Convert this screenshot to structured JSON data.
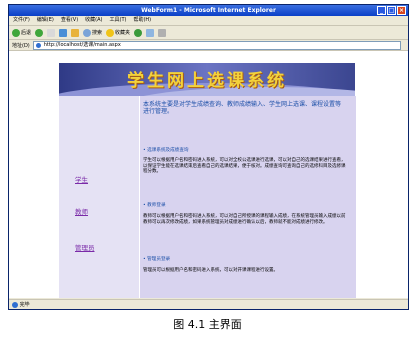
{
  "window": {
    "title": "WebForm1 - Microsoft Internet Explorer",
    "controls": {
      "min": "_",
      "max": "□",
      "close": "×"
    }
  },
  "menu": [
    "文件(F)",
    "编辑(E)",
    "查看(V)",
    "收藏(A)",
    "工具(T)",
    "帮助(H)"
  ],
  "toolbar": {
    "back": "后退",
    "search": "搜索",
    "favorites": "收藏夹"
  },
  "address": {
    "label": "地址(D)",
    "url": "http://localhost/选课/main.aspx"
  },
  "banner": {
    "title": "学生网上选课系统"
  },
  "nav": {
    "student": "学生",
    "teacher": "教师",
    "admin": "管理员"
  },
  "intro": "本系统主要是对学生成绩查询、教师成绩输入、学生网上选课、课程设置等进行管理。",
  "sections": [
    {
      "heading": "• 选课系统及成绩查询",
      "body": "学生可以根据用户名和密码进入系统，可以对全校公选课进行选课，可以对自己的选课结果进行查看，以保证学生能在选课结束后查看自己的选课结果，便于核对。成绩查询可查询自己的选修科目及选修课程分数。"
    },
    {
      "heading": "• 教师登录",
      "body": "教师可以根据用户名和密码进入系统，可以对自己所授课的课程输入成绩，在系统管理员输入成绩以前教师可以再次修改成绩，如果系统管理员对成绩进行确认以后，教师就不能对成绩进行修改。"
    },
    {
      "heading": "• 管理员登录",
      "body": "管理员可以根据用户名和密码进入系统，可以对开课课程进行设置。"
    }
  ],
  "status": "完毕",
  "caption": "图 4.1 主界面"
}
